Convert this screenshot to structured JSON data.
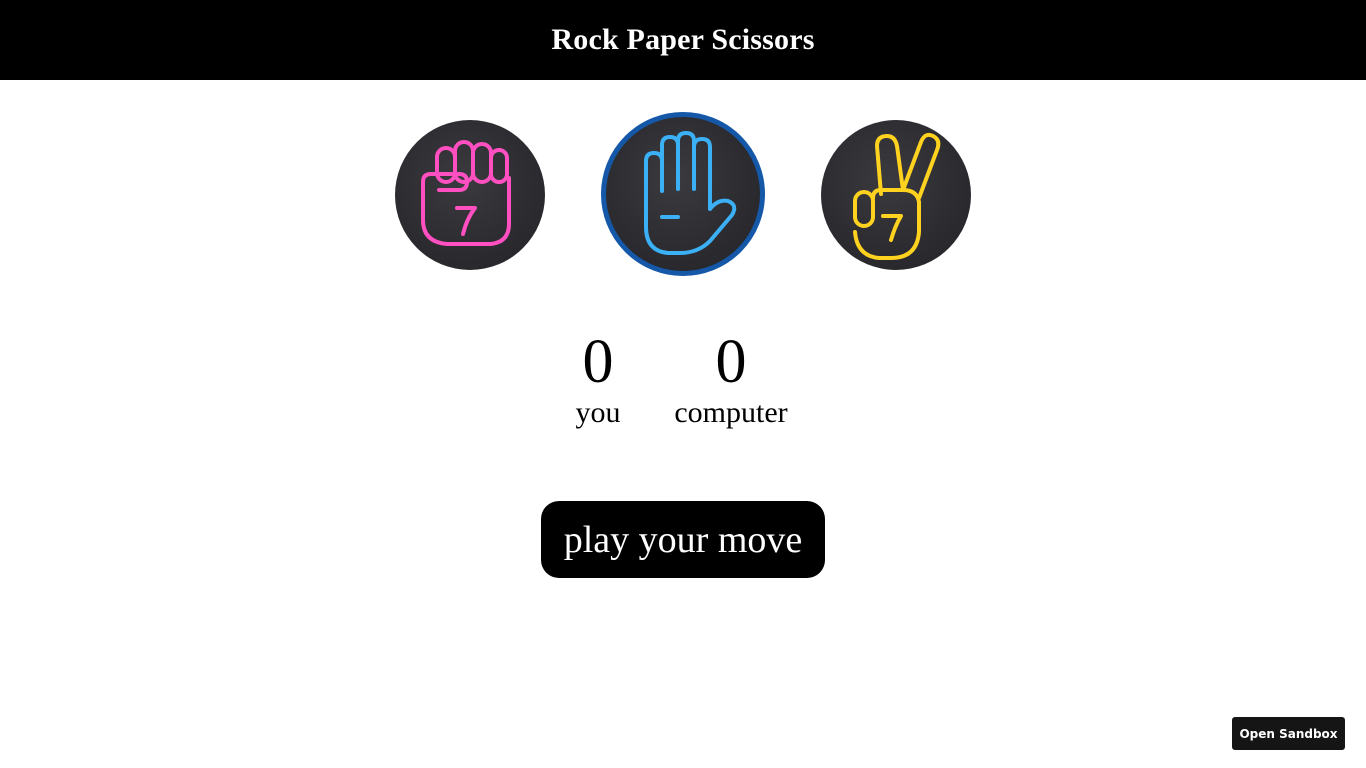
{
  "header": {
    "title": "Rock Paper Scissors"
  },
  "choices": [
    {
      "name": "rock",
      "icon": "fist-icon",
      "color": "#ff4fc0",
      "selected": false
    },
    {
      "name": "paper",
      "icon": "open-hand-icon",
      "color": "#3bb0f5",
      "selected": true
    },
    {
      "name": "scissors",
      "icon": "peace-sign-icon",
      "color": "#ffd21f",
      "selected": false
    }
  ],
  "selected_border_color": "#1558a8",
  "score": {
    "you": {
      "value": "0",
      "label": "you"
    },
    "computer": {
      "value": "0",
      "label": "computer"
    }
  },
  "play_button": {
    "label": "play your move"
  },
  "sandbox_button": {
    "label": "Open Sandbox"
  }
}
